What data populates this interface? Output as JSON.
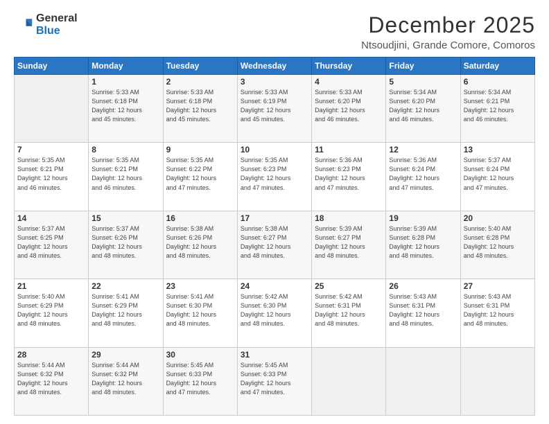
{
  "logo": {
    "general": "General",
    "blue": "Blue"
  },
  "title": "December 2025",
  "subtitle": "Ntsoudjini, Grande Comore, Comoros",
  "days_of_week": [
    "Sunday",
    "Monday",
    "Tuesday",
    "Wednesday",
    "Thursday",
    "Friday",
    "Saturday"
  ],
  "weeks": [
    [
      {
        "day": "",
        "detail": ""
      },
      {
        "day": "1",
        "detail": "Sunrise: 5:33 AM\nSunset: 6:18 PM\nDaylight: 12 hours\nand 45 minutes."
      },
      {
        "day": "2",
        "detail": "Sunrise: 5:33 AM\nSunset: 6:18 PM\nDaylight: 12 hours\nand 45 minutes."
      },
      {
        "day": "3",
        "detail": "Sunrise: 5:33 AM\nSunset: 6:19 PM\nDaylight: 12 hours\nand 45 minutes."
      },
      {
        "day": "4",
        "detail": "Sunrise: 5:33 AM\nSunset: 6:20 PM\nDaylight: 12 hours\nand 46 minutes."
      },
      {
        "day": "5",
        "detail": "Sunrise: 5:34 AM\nSunset: 6:20 PM\nDaylight: 12 hours\nand 46 minutes."
      },
      {
        "day": "6",
        "detail": "Sunrise: 5:34 AM\nSunset: 6:21 PM\nDaylight: 12 hours\nand 46 minutes."
      }
    ],
    [
      {
        "day": "7",
        "detail": ""
      },
      {
        "day": "8",
        "detail": "Sunrise: 5:35 AM\nSunset: 6:21 PM\nDaylight: 12 hours\nand 46 minutes."
      },
      {
        "day": "9",
        "detail": "Sunrise: 5:35 AM\nSunset: 6:22 PM\nDaylight: 12 hours\nand 47 minutes."
      },
      {
        "day": "10",
        "detail": "Sunrise: 5:35 AM\nSunset: 6:23 PM\nDaylight: 12 hours\nand 47 minutes."
      },
      {
        "day": "11",
        "detail": "Sunrise: 5:36 AM\nSunset: 6:23 PM\nDaylight: 12 hours\nand 47 minutes."
      },
      {
        "day": "12",
        "detail": "Sunrise: 5:36 AM\nSunset: 6:24 PM\nDaylight: 12 hours\nand 47 minutes."
      },
      {
        "day": "13",
        "detail": "Sunrise: 5:37 AM\nSunset: 6:24 PM\nDaylight: 12 hours\nand 47 minutes."
      }
    ],
    [
      {
        "day": "14",
        "detail": ""
      },
      {
        "day": "15",
        "detail": "Sunrise: 5:37 AM\nSunset: 6:26 PM\nDaylight: 12 hours\nand 48 minutes."
      },
      {
        "day": "16",
        "detail": "Sunrise: 5:38 AM\nSunset: 6:26 PM\nDaylight: 12 hours\nand 48 minutes."
      },
      {
        "day": "17",
        "detail": "Sunrise: 5:38 AM\nSunset: 6:27 PM\nDaylight: 12 hours\nand 48 minutes."
      },
      {
        "day": "18",
        "detail": "Sunrise: 5:39 AM\nSunset: 6:27 PM\nDaylight: 12 hours\nand 48 minutes."
      },
      {
        "day": "19",
        "detail": "Sunrise: 5:39 AM\nSunset: 6:28 PM\nDaylight: 12 hours\nand 48 minutes."
      },
      {
        "day": "20",
        "detail": "Sunrise: 5:40 AM\nSunset: 6:28 PM\nDaylight: 12 hours\nand 48 minutes."
      }
    ],
    [
      {
        "day": "21",
        "detail": ""
      },
      {
        "day": "22",
        "detail": "Sunrise: 5:41 AM\nSunset: 6:29 PM\nDaylight: 12 hours\nand 48 minutes."
      },
      {
        "day": "23",
        "detail": "Sunrise: 5:41 AM\nSunset: 6:30 PM\nDaylight: 12 hours\nand 48 minutes."
      },
      {
        "day": "24",
        "detail": "Sunrise: 5:42 AM\nSunset: 6:30 PM\nDaylight: 12 hours\nand 48 minutes."
      },
      {
        "day": "25",
        "detail": "Sunrise: 5:42 AM\nSunset: 6:31 PM\nDaylight: 12 hours\nand 48 minutes."
      },
      {
        "day": "26",
        "detail": "Sunrise: 5:43 AM\nSunset: 6:31 PM\nDaylight: 12 hours\nand 48 minutes."
      },
      {
        "day": "27",
        "detail": "Sunrise: 5:43 AM\nSunset: 6:31 PM\nDaylight: 12 hours\nand 48 minutes."
      }
    ],
    [
      {
        "day": "28",
        "detail": "Sunrise: 5:44 AM\nSunset: 6:32 PM\nDaylight: 12 hours\nand 48 minutes."
      },
      {
        "day": "29",
        "detail": "Sunrise: 5:44 AM\nSunset: 6:32 PM\nDaylight: 12 hours\nand 48 minutes."
      },
      {
        "day": "30",
        "detail": "Sunrise: 5:45 AM\nSunset: 6:33 PM\nDaylight: 12 hours\nand 47 minutes."
      },
      {
        "day": "31",
        "detail": "Sunrise: 5:45 AM\nSunset: 6:33 PM\nDaylight: 12 hours\nand 47 minutes."
      },
      {
        "day": "",
        "detail": ""
      },
      {
        "day": "",
        "detail": ""
      },
      {
        "day": "",
        "detail": ""
      }
    ]
  ],
  "week1_sunday_detail": "Sunrise: 5:34 AM\nSunset: 6:21 PM\nDaylight: 12 hours\nand 46 minutes.",
  "week2_sunday_detail": "Sunrise: 5:35 AM\nSunset: 6:21 PM\nDaylight: 12 hours\nand 46 minutes.",
  "week3_sunday_detail": "Sunrise: 5:37 AM\nSunset: 6:25 PM\nDaylight: 12 hours\nand 48 minutes.",
  "week4_sunday_detail": "Sunrise: 5:40 AM\nSunset: 6:29 PM\nDaylight: 12 hours\nand 48 minutes."
}
